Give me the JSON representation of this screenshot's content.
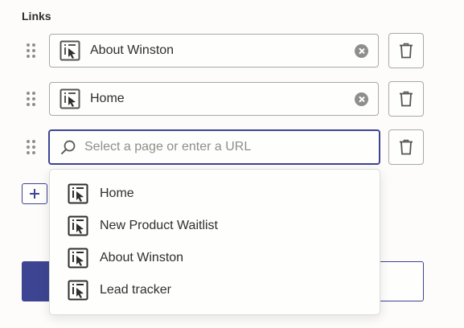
{
  "section": {
    "label": "Links"
  },
  "links": [
    {
      "label": "About Winston",
      "icon": "page-icon"
    },
    {
      "label": "Home",
      "icon": "page-icon"
    }
  ],
  "search": {
    "placeholder": "Select a page or enter a URL",
    "value": ""
  },
  "dropdown": {
    "items": [
      {
        "label": "Home"
      },
      {
        "label": "New Product Waitlist"
      },
      {
        "label": "About Winston"
      },
      {
        "label": "Lead tracker"
      }
    ]
  },
  "colors": {
    "accent": "#3d4592",
    "text": "#2d2e2e",
    "muted": "#8e8e8a",
    "border": "#a8a8a4",
    "background": "#fdfcfa"
  }
}
